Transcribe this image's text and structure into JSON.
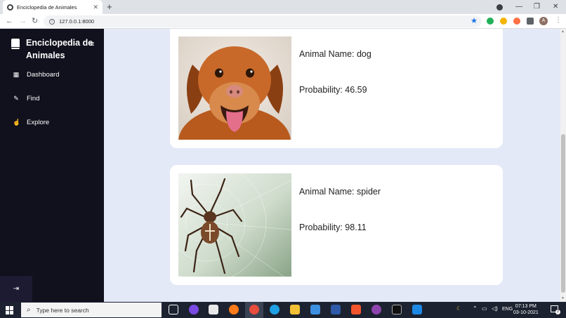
{
  "browser": {
    "tab_title": "Enciclopedia de Animales",
    "tab_close": "✕",
    "new_tab": "+",
    "url": "127.0.0.1:8000",
    "minimize": "—",
    "restore": "❐",
    "close": "✕",
    "avatar_letter": "A"
  },
  "sidebar": {
    "brand": "Enciclopedia de Animales",
    "menu_icon": "≡",
    "items": [
      {
        "label": "Dashboard",
        "icon": "grid-icon"
      },
      {
        "label": "Find",
        "icon": "pencil-icon"
      },
      {
        "label": "Explore",
        "icon": "hand-pointer-icon"
      }
    ],
    "logout_icon": "logout-icon"
  },
  "results": [
    {
      "name_label": "Animal Name: dog",
      "prob_label": "Probability: 46.59",
      "image": "dog-photo"
    },
    {
      "name_label": "Animal Name: spider",
      "prob_label": "Probability: 98.11",
      "image": "spider-photo"
    }
  ],
  "taskbar": {
    "search_placeholder": "Type here to search",
    "language": "ENG",
    "time": "07:13 PM",
    "date": "03-10-2021",
    "notifications": "2"
  },
  "colors": {
    "sidebar_bg": "#11101d",
    "content_bg": "#e4e9f7",
    "card_bg": "#ffffff"
  }
}
